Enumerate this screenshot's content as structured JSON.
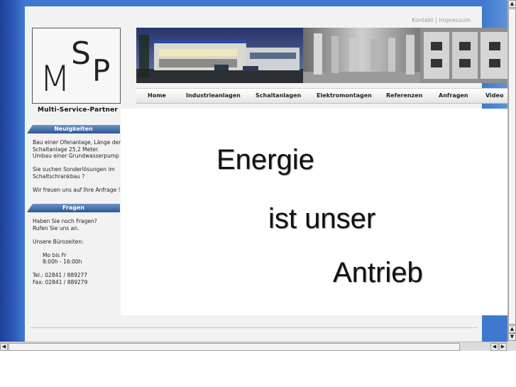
{
  "top_links": {
    "contact": "Kontakt",
    "separator": "|",
    "imprint": "Impressum"
  },
  "logo": {
    "letters": [
      "M",
      "S",
      "P"
    ]
  },
  "brand": "Multi-Service-Partner",
  "news": {
    "heading": "Neuigkeiten",
    "lines": [
      "Bau einer Ofenanlage, Länge der",
      "Schaltanlage 25,2 Meter.",
      "Umbau einer Grundwasserpump",
      "",
      "Sie suchen Sonderlösungen im",
      "Schaltschrankbau ?",
      "",
      "Wir freuen uns auf Ihre Anfrage !"
    ]
  },
  "questions": {
    "heading": "Fragen",
    "lines": [
      "Haben Sie noch Fragen?",
      "Rufen Sie uns an.",
      "",
      "Unsere Bürozeiten:",
      "",
      "     Mo bis Fr",
      "     8:00h - 16:00h",
      "",
      "Tel.: 02841 / 889277",
      "Fax: 02841 / 889279"
    ]
  },
  "nav": [
    "Home",
    "Industrieanlagen",
    "Schaltanlagen",
    "Elektromontagen",
    "Referenzen",
    "Anfragen",
    "Video"
  ],
  "slogan": [
    "Energie",
    "ist unser",
    "Antrieb"
  ],
  "colors": {
    "page_bg": "#3f79cf",
    "sidebar_heading": "#2d5797",
    "content_bg": "#ffffff"
  }
}
